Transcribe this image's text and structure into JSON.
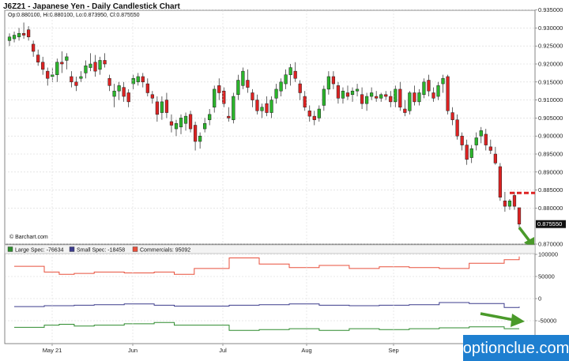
{
  "chart_data": [
    {
      "type": "candlestick",
      "title": "J6Z21 - Japanese Yen - Daily Candlestick Chart",
      "ohlc_label": "Op:0.880100, Hi:0.880100, Lo:0.873950, Cl:0.875550",
      "credit": "© Barchart.com",
      "last_price_label": "0.875550",
      "ylim": [
        0.87,
        0.935
      ],
      "yticks": [
        "0.935000",
        "0.930000",
        "0.925000",
        "0.920000",
        "0.915000",
        "0.910000",
        "0.905000",
        "0.900000",
        "0.895000",
        "0.890000",
        "0.885000",
        "0.880000",
        "0.875550",
        "0.870000"
      ],
      "x_labels": [
        "May 21",
        "Jun",
        "Jul",
        "Aug",
        "Sep"
      ],
      "annotation_level": 0.8842,
      "colors": {
        "up": "#2bb52b",
        "down": "#dd2222",
        "annotation": "#dd2222",
        "arrow": "#4a9a2a"
      },
      "candles": [
        {
          "o": 0.9265,
          "h": 0.9285,
          "l": 0.925,
          "c": 0.9275
        },
        {
          "o": 0.927,
          "h": 0.929,
          "l": 0.926,
          "c": 0.928
        },
        {
          "o": 0.9275,
          "h": 0.93,
          "l": 0.9265,
          "c": 0.9285
        },
        {
          "o": 0.9285,
          "h": 0.9315,
          "l": 0.927,
          "c": 0.928
        },
        {
          "o": 0.9295,
          "h": 0.9305,
          "l": 0.9265,
          "c": 0.9275
        },
        {
          "o": 0.9255,
          "h": 0.9265,
          "l": 0.922,
          "c": 0.9235
        },
        {
          "o": 0.9225,
          "h": 0.924,
          "l": 0.9195,
          "c": 0.9205
        },
        {
          "o": 0.9205,
          "h": 0.922,
          "l": 0.917,
          "c": 0.9185
        },
        {
          "o": 0.918,
          "h": 0.919,
          "l": 0.914,
          "c": 0.916
        },
        {
          "o": 0.9165,
          "h": 0.919,
          "l": 0.915,
          "c": 0.917
        },
        {
          "o": 0.917,
          "h": 0.9215,
          "l": 0.915,
          "c": 0.9205
        },
        {
          "o": 0.9205,
          "h": 0.9235,
          "l": 0.9175,
          "c": 0.92
        },
        {
          "o": 0.921,
          "h": 0.923,
          "l": 0.9185,
          "c": 0.922
        },
        {
          "o": 0.9165,
          "h": 0.918,
          "l": 0.9135,
          "c": 0.915
        },
        {
          "o": 0.915,
          "h": 0.9165,
          "l": 0.9125,
          "c": 0.914
        },
        {
          "o": 0.916,
          "h": 0.918,
          "l": 0.915,
          "c": 0.9165
        },
        {
          "o": 0.9175,
          "h": 0.921,
          "l": 0.916,
          "c": 0.9195
        },
        {
          "o": 0.919,
          "h": 0.923,
          "l": 0.918,
          "c": 0.92
        },
        {
          "o": 0.9205,
          "h": 0.9225,
          "l": 0.9165,
          "c": 0.918
        },
        {
          "o": 0.9185,
          "h": 0.922,
          "l": 0.917,
          "c": 0.921
        },
        {
          "o": 0.921,
          "h": 0.923,
          "l": 0.919,
          "c": 0.92
        },
        {
          "o": 0.916,
          "h": 0.917,
          "l": 0.9125,
          "c": 0.914
        },
        {
          "o": 0.911,
          "h": 0.9145,
          "l": 0.908,
          "c": 0.9125
        },
        {
          "o": 0.9125,
          "h": 0.915,
          "l": 0.91,
          "c": 0.914
        },
        {
          "o": 0.9135,
          "h": 0.915,
          "l": 0.9095,
          "c": 0.911
        },
        {
          "o": 0.912,
          "h": 0.913,
          "l": 0.908,
          "c": 0.9095
        },
        {
          "o": 0.9145,
          "h": 0.917,
          "l": 0.913,
          "c": 0.916
        },
        {
          "o": 0.915,
          "h": 0.9175,
          "l": 0.914,
          "c": 0.9165
        },
        {
          "o": 0.9165,
          "h": 0.9175,
          "l": 0.9135,
          "c": 0.915
        },
        {
          "o": 0.9145,
          "h": 0.916,
          "l": 0.911,
          "c": 0.912
        },
        {
          "o": 0.9115,
          "h": 0.9125,
          "l": 0.909,
          "c": 0.9105
        },
        {
          "o": 0.9095,
          "h": 0.911,
          "l": 0.904,
          "c": 0.906
        },
        {
          "o": 0.9065,
          "h": 0.911,
          "l": 0.9045,
          "c": 0.9095
        },
        {
          "o": 0.91,
          "h": 0.912,
          "l": 0.905,
          "c": 0.9065
        },
        {
          "o": 0.904,
          "h": 0.906,
          "l": 0.901,
          "c": 0.903
        },
        {
          "o": 0.902,
          "h": 0.9045,
          "l": 0.9,
          "c": 0.9035
        },
        {
          "o": 0.9025,
          "h": 0.906,
          "l": 0.9005,
          "c": 0.905
        },
        {
          "o": 0.9035,
          "h": 0.9065,
          "l": 0.9015,
          "c": 0.9055
        },
        {
          "o": 0.906,
          "h": 0.907,
          "l": 0.901,
          "c": 0.902
        },
        {
          "o": 0.903,
          "h": 0.904,
          "l": 0.896,
          "c": 0.8985
        },
        {
          "o": 0.8985,
          "h": 0.901,
          "l": 0.8965,
          "c": 0.9
        },
        {
          "o": 0.902,
          "h": 0.905,
          "l": 0.901,
          "c": 0.9035
        },
        {
          "o": 0.9045,
          "h": 0.9075,
          "l": 0.903,
          "c": 0.906
        },
        {
          "o": 0.908,
          "h": 0.914,
          "l": 0.9065,
          "c": 0.913
        },
        {
          "o": 0.914,
          "h": 0.916,
          "l": 0.91,
          "c": 0.912
        },
        {
          "o": 0.9125,
          "h": 0.9135,
          "l": 0.908,
          "c": 0.909
        },
        {
          "o": 0.9055,
          "h": 0.908,
          "l": 0.904,
          "c": 0.905
        },
        {
          "o": 0.9045,
          "h": 0.912,
          "l": 0.9035,
          "c": 0.911
        },
        {
          "o": 0.9115,
          "h": 0.917,
          "l": 0.91,
          "c": 0.9155
        },
        {
          "o": 0.914,
          "h": 0.919,
          "l": 0.913,
          "c": 0.918
        },
        {
          "o": 0.9155,
          "h": 0.9185,
          "l": 0.912,
          "c": 0.9135
        },
        {
          "o": 0.912,
          "h": 0.913,
          "l": 0.908,
          "c": 0.91
        },
        {
          "o": 0.91,
          "h": 0.9115,
          "l": 0.906,
          "c": 0.907
        },
        {
          "o": 0.907,
          "h": 0.909,
          "l": 0.905,
          "c": 0.908
        },
        {
          "o": 0.909,
          "h": 0.911,
          "l": 0.9055,
          "c": 0.9065
        },
        {
          "o": 0.9065,
          "h": 0.911,
          "l": 0.905,
          "c": 0.91
        },
        {
          "o": 0.9105,
          "h": 0.9145,
          "l": 0.909,
          "c": 0.913
        },
        {
          "o": 0.9125,
          "h": 0.916,
          "l": 0.911,
          "c": 0.915
        },
        {
          "o": 0.9145,
          "h": 0.9185,
          "l": 0.913,
          "c": 0.917
        },
        {
          "o": 0.917,
          "h": 0.92,
          "l": 0.914,
          "c": 0.919
        },
        {
          "o": 0.918,
          "h": 0.9205,
          "l": 0.915,
          "c": 0.916
        },
        {
          "o": 0.9145,
          "h": 0.9155,
          "l": 0.91,
          "c": 0.912
        },
        {
          "o": 0.911,
          "h": 0.9125,
          "l": 0.907,
          "c": 0.908
        },
        {
          "o": 0.907,
          "h": 0.9085,
          "l": 0.904,
          "c": 0.9055
        },
        {
          "o": 0.9055,
          "h": 0.907,
          "l": 0.903,
          "c": 0.9045
        },
        {
          "o": 0.905,
          "h": 0.9085,
          "l": 0.904,
          "c": 0.9075
        },
        {
          "o": 0.9085,
          "h": 0.914,
          "l": 0.907,
          "c": 0.913
        },
        {
          "o": 0.913,
          "h": 0.918,
          "l": 0.9115,
          "c": 0.9165
        },
        {
          "o": 0.9165,
          "h": 0.918,
          "l": 0.913,
          "c": 0.9145
        },
        {
          "o": 0.914,
          "h": 0.915,
          "l": 0.909,
          "c": 0.9105
        },
        {
          "o": 0.9105,
          "h": 0.9135,
          "l": 0.909,
          "c": 0.9125
        },
        {
          "o": 0.912,
          "h": 0.914,
          "l": 0.91,
          "c": 0.911
        },
        {
          "o": 0.9115,
          "h": 0.9135,
          "l": 0.9095,
          "c": 0.9125
        },
        {
          "o": 0.9125,
          "h": 0.9145,
          "l": 0.911,
          "c": 0.913
        },
        {
          "o": 0.9115,
          "h": 0.9135,
          "l": 0.9075,
          "c": 0.909
        },
        {
          "o": 0.909,
          "h": 0.912,
          "l": 0.907,
          "c": 0.911
        },
        {
          "o": 0.911,
          "h": 0.9135,
          "l": 0.91,
          "c": 0.912
        },
        {
          "o": 0.911,
          "h": 0.9125,
          "l": 0.9095,
          "c": 0.9105
        },
        {
          "o": 0.9105,
          "h": 0.912,
          "l": 0.9095,
          "c": 0.9115
        },
        {
          "o": 0.9115,
          "h": 0.9125,
          "l": 0.91,
          "c": 0.911
        },
        {
          "o": 0.911,
          "h": 0.9125,
          "l": 0.908,
          "c": 0.9095
        },
        {
          "o": 0.9095,
          "h": 0.914,
          "l": 0.908,
          "c": 0.913
        },
        {
          "o": 0.913,
          "h": 0.915,
          "l": 0.907,
          "c": 0.908
        },
        {
          "o": 0.9075,
          "h": 0.91,
          "l": 0.9055,
          "c": 0.9065
        },
        {
          "o": 0.907,
          "h": 0.9125,
          "l": 0.906,
          "c": 0.912
        },
        {
          "o": 0.912,
          "h": 0.914,
          "l": 0.9085,
          "c": 0.9095
        },
        {
          "o": 0.9095,
          "h": 0.913,
          "l": 0.9085,
          "c": 0.912
        },
        {
          "o": 0.9115,
          "h": 0.916,
          "l": 0.9105,
          "c": 0.915
        },
        {
          "o": 0.9155,
          "h": 0.917,
          "l": 0.911,
          "c": 0.9125
        },
        {
          "o": 0.912,
          "h": 0.9135,
          "l": 0.9095,
          "c": 0.9105
        },
        {
          "o": 0.911,
          "h": 0.915,
          "l": 0.91,
          "c": 0.914
        },
        {
          "o": 0.9145,
          "h": 0.917,
          "l": 0.912,
          "c": 0.916
        },
        {
          "o": 0.9165,
          "h": 0.917,
          "l": 0.906,
          "c": 0.907
        },
        {
          "o": 0.9065,
          "h": 0.908,
          "l": 0.903,
          "c": 0.9045
        },
        {
          "o": 0.9045,
          "h": 0.906,
          "l": 0.899,
          "c": 0.9
        },
        {
          "o": 0.9,
          "h": 0.901,
          "l": 0.896,
          "c": 0.8975
        },
        {
          "o": 0.8975,
          "h": 0.899,
          "l": 0.892,
          "c": 0.8935
        },
        {
          "o": 0.894,
          "h": 0.8975,
          "l": 0.8925,
          "c": 0.8965
        },
        {
          "o": 0.8975,
          "h": 0.901,
          "l": 0.896,
          "c": 0.8995
        },
        {
          "o": 0.9,
          "h": 0.9025,
          "l": 0.898,
          "c": 0.9015
        },
        {
          "o": 0.9005,
          "h": 0.902,
          "l": 0.896,
          "c": 0.8975
        },
        {
          "o": 0.897,
          "h": 0.899,
          "l": 0.895,
          "c": 0.896
        },
        {
          "o": 0.895,
          "h": 0.897,
          "l": 0.892,
          "c": 0.8925
        },
        {
          "o": 0.8915,
          "h": 0.8925,
          "l": 0.882,
          "c": 0.883
        },
        {
          "o": 0.882,
          "h": 0.8845,
          "l": 0.879,
          "c": 0.8805
        },
        {
          "o": 0.8805,
          "h": 0.8825,
          "l": 0.8795,
          "c": 0.882
        },
        {
          "o": 0.8835,
          "h": 0.8845,
          "l": 0.8795,
          "c": 0.8805
        },
        {
          "o": 0.8801,
          "h": 0.8801,
          "l": 0.87395,
          "c": 0.87555
        }
      ]
    },
    {
      "type": "line",
      "title": "",
      "ylim": [
        -100000,
        100000
      ],
      "yticks": [
        "100000",
        "50000",
        "0",
        "-50000"
      ],
      "x_labels": [
        "May 21",
        "Jun",
        "Jul",
        "Aug",
        "Sep"
      ],
      "x_count": 102,
      "series": [
        {
          "name": "Large Spec: -76634",
          "color": "#2e8b2e",
          "step": true,
          "values": [
            -65000,
            -65000,
            -65000,
            -65000,
            -65000,
            -65000,
            -60000,
            -60000,
            -60000,
            -58000,
            -58000,
            -58000,
            -62000,
            -62000,
            -62000,
            -62000,
            -60000,
            -60000,
            -60000,
            -60000,
            -60000,
            -60000,
            -57000,
            -57000,
            -57000,
            -57000,
            -57000,
            -57000,
            -54000,
            -54000,
            -54000,
            -54000,
            -60000,
            -60000,
            -60000,
            -60000,
            -60000,
            -60000,
            -60000,
            -60000,
            -60000,
            -60000,
            -60000,
            -72000,
            -72000,
            -72000,
            -72000,
            -72000,
            -72000,
            -70000,
            -70000,
            -70000,
            -70000,
            -70000,
            -70000,
            -68000,
            -68000,
            -68000,
            -68000,
            -68000,
            -68000,
            -72000,
            -72000,
            -72000,
            -72000,
            -72000,
            -72000,
            -68000,
            -68000,
            -68000,
            -68000,
            -68000,
            -68000,
            -70000,
            -70000,
            -70000,
            -70000,
            -70000,
            -70000,
            -68000,
            -68000,
            -68000,
            -68000,
            -68000,
            -68000,
            -66000,
            -66000,
            -66000,
            -66000,
            -66000,
            -66000,
            -64000,
            -64000,
            -64000,
            -64000,
            -64000,
            -64000,
            -64000,
            -68000,
            -68000,
            -68000,
            -68000
          ]
        },
        {
          "name": "Small Spec: -18458",
          "color": "#3c3c8c",
          "step": true,
          "values": [
            -18000,
            -18000,
            -18000,
            -18000,
            -18000,
            -18000,
            -16000,
            -16000,
            -16000,
            -16000,
            -16000,
            -16000,
            -15000,
            -15000,
            -15000,
            -15000,
            -14000,
            -14000,
            -14000,
            -14000,
            -14000,
            -14000,
            -12000,
            -12000,
            -12000,
            -12000,
            -12000,
            -12000,
            -15000,
            -15000,
            -15000,
            -15000,
            -17000,
            -17000,
            -17000,
            -17000,
            -17000,
            -17000,
            -17000,
            -17000,
            -17000,
            -17000,
            -17000,
            -15000,
            -15000,
            -15000,
            -15000,
            -15000,
            -15000,
            -14000,
            -14000,
            -14000,
            -14000,
            -14000,
            -14000,
            -12000,
            -12000,
            -12000,
            -12000,
            -12000,
            -12000,
            -15000,
            -15000,
            -15000,
            -15000,
            -15000,
            -15000,
            -16000,
            -16000,
            -16000,
            -16000,
            -16000,
            -16000,
            -15000,
            -15000,
            -15000,
            -15000,
            -15000,
            -15000,
            -14000,
            -14000,
            -14000,
            -14000,
            -14000,
            -14000,
            -9000,
            -9000,
            -9000,
            -9000,
            -9000,
            -9000,
            -11000,
            -11000,
            -11000,
            -11000,
            -11000,
            -11000,
            -11000,
            -20000,
            -20000,
            -20000,
            -18458
          ]
        },
        {
          "name": "Commercials: 95092",
          "color": "#e8503c",
          "step": true,
          "values": [
            73000,
            73000,
            73000,
            73000,
            73000,
            73000,
            60000,
            60000,
            60000,
            55000,
            55000,
            55000,
            57000,
            57000,
            57000,
            57000,
            60000,
            60000,
            60000,
            60000,
            60000,
            60000,
            58000,
            58000,
            58000,
            58000,
            58000,
            58000,
            60000,
            60000,
            60000,
            60000,
            55000,
            55000,
            55000,
            55000,
            68000,
            68000,
            68000,
            68000,
            68000,
            68000,
            68000,
            92000,
            92000,
            92000,
            92000,
            92000,
            92000,
            78000,
            78000,
            78000,
            78000,
            78000,
            78000,
            70000,
            70000,
            70000,
            70000,
            70000,
            70000,
            75000,
            75000,
            75000,
            75000,
            75000,
            75000,
            68000,
            68000,
            68000,
            68000,
            68000,
            68000,
            72000,
            72000,
            72000,
            72000,
            72000,
            72000,
            70000,
            70000,
            70000,
            70000,
            70000,
            70000,
            68000,
            68000,
            68000,
            68000,
            68000,
            68000,
            80000,
            80000,
            80000,
            80000,
            80000,
            80000,
            80000,
            88000,
            88000,
            88000,
            95092
          ]
        }
      ],
      "colors": {
        "arrow": "#4a9a2a"
      }
    }
  ],
  "logo": {
    "text": "optionclue.com",
    "bg": "#1e7fd0"
  }
}
